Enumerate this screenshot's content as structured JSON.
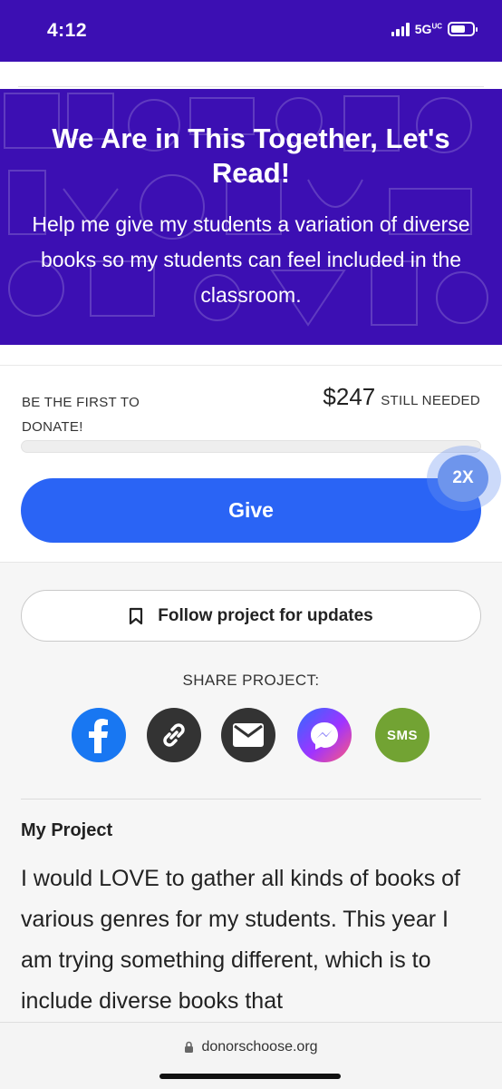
{
  "status_bar": {
    "time": "4:12",
    "network": "5G",
    "network_suffix": "UC",
    "icons": [
      "signal-icon",
      "battery-icon"
    ]
  },
  "hero": {
    "title": "We Are in This Together, Let's Read!",
    "subtitle": "Help me give my students a variation of diverse books so my students can feel included in the classroom.",
    "background_color": "#3c0fb3"
  },
  "donation": {
    "first_donor_text": "BE THE FIRST TO DONATE!",
    "amount_needed": "$247",
    "still_needed_label": "STILL NEEDED",
    "progress_fraction": 0.0,
    "give_label": "Give",
    "match_badge": "2X",
    "accent_color": "#2a64f5"
  },
  "follow": {
    "label": "Follow project for updates",
    "icon": "bookmark-icon"
  },
  "share": {
    "title": "SHARE PROJECT:",
    "icons": [
      "facebook-icon",
      "link-icon",
      "email-icon",
      "messenger-icon",
      "sms-icon"
    ],
    "sms_label": "SMS",
    "colors": {
      "facebook": "#1877f2",
      "link": "#333333",
      "email": "#333333",
      "sms": "#72a333"
    }
  },
  "project": {
    "section_title": "My Project",
    "body": "I would LOVE to gather all kinds of books of various genres for my students. This year I am trying something different, which is to include diverse books that"
  },
  "browser": {
    "url": "donorschoose.org",
    "icon": "lock-icon"
  }
}
